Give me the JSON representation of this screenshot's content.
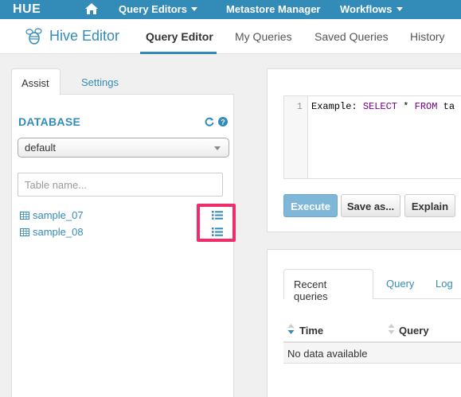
{
  "topbar": {
    "logo": "HUE",
    "items": [
      {
        "label": "Query Editors"
      },
      {
        "label": "Metastore Manager"
      },
      {
        "label": "Workflows"
      }
    ]
  },
  "subbar": {
    "app_title": "Hive Editor",
    "tabs": [
      {
        "label": "Query Editor"
      },
      {
        "label": "My Queries"
      },
      {
        "label": "Saved Queries"
      },
      {
        "label": "History"
      }
    ]
  },
  "assist": {
    "tabs": [
      {
        "label": "Assist"
      },
      {
        "label": "Settings"
      }
    ],
    "section_title": "DATABASE",
    "database_select": "default",
    "table_filter_placeholder": "Table name...",
    "tables": [
      {
        "name": "sample_07"
      },
      {
        "name": "sample_08"
      }
    ]
  },
  "editor": {
    "line_number": "1",
    "code_prefix": "Example: ",
    "code_kw1": "SELECT",
    "code_mid": " * ",
    "code_kw2": "FROM",
    "code_suffix": " ta",
    "buttons": {
      "execute": "Execute",
      "save_as": "Save as...",
      "explain": "Explain"
    }
  },
  "results": {
    "tabs": [
      {
        "label": "Recent queries"
      },
      {
        "label": "Query"
      },
      {
        "label": "Log"
      }
    ],
    "columns": [
      "Time",
      "Query"
    ],
    "empty_text": "No data available"
  },
  "colors": {
    "brand": "#338bb8",
    "highlight": "#ee2e6b"
  }
}
